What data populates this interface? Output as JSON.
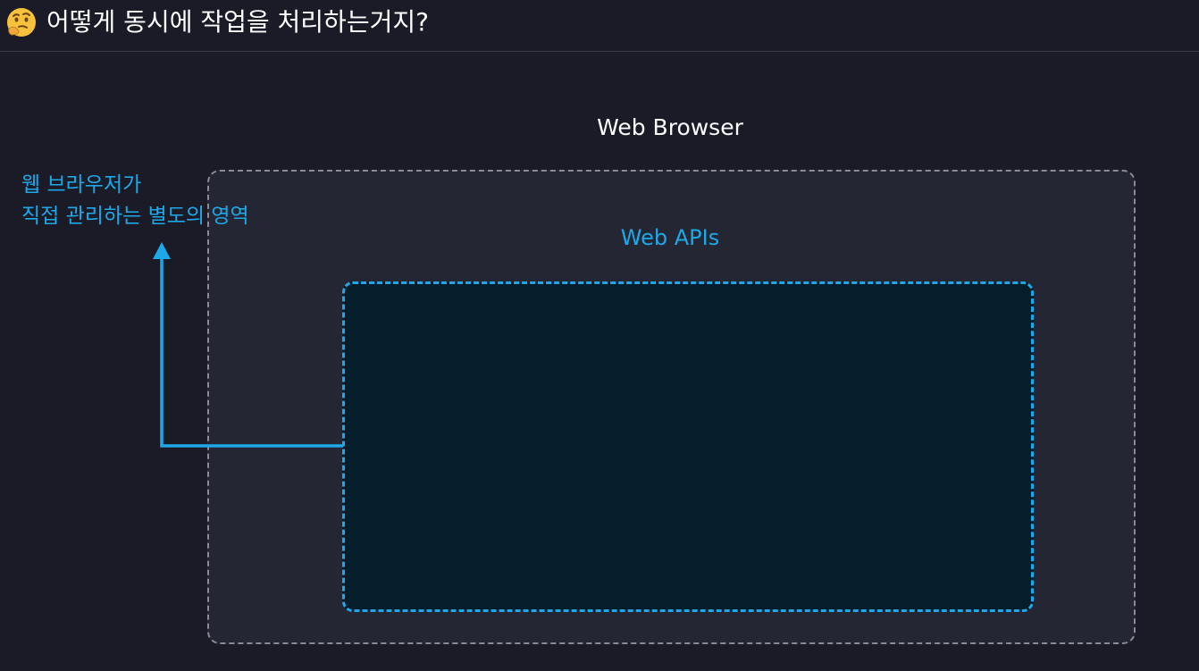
{
  "header": {
    "emoji_icon": "thinking-face-icon",
    "title": "어떻게 동시에 작업을 처리하는거지?"
  },
  "diagram": {
    "browser_label": "Web Browser",
    "apis_label": "Web APIs",
    "note_line1": "웹 브라우저가",
    "note_line2": "직접 관리하는 별도의 영역"
  },
  "colors": {
    "background": "#1a1b27",
    "browser_fill": "#252633",
    "browser_border": "#8a8b93",
    "apis_fill": "#061e2b",
    "accent": "#1fa8e8",
    "text": "#ffffff"
  }
}
